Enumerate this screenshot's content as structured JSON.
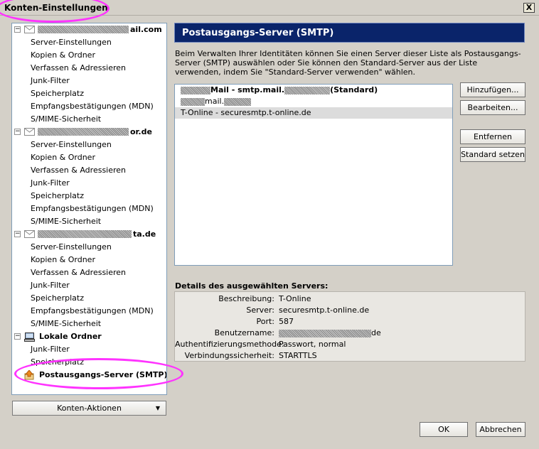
{
  "window": {
    "title": "Konten-Einstellungen",
    "close_label": "X"
  },
  "tree": {
    "accounts": [
      {
        "name_suffix": "ail.com",
        "expander": "−",
        "items": [
          "Server-Einstellungen",
          "Kopien & Ordner",
          "Verfassen & Adressieren",
          "Junk-Filter",
          "Speicherplatz",
          "Empfangsbestätigungen (MDN)",
          "S/MIME-Sicherheit"
        ]
      },
      {
        "name_suffix": "or.de",
        "expander": "−",
        "items": [
          "Server-Einstellungen",
          "Kopien & Ordner",
          "Verfassen & Adressieren",
          "Junk-Filter",
          "Speicherplatz",
          "Empfangsbestätigungen (MDN)",
          "S/MIME-Sicherheit"
        ]
      },
      {
        "name_suffix": "ta.de",
        "expander": "−",
        "items": [
          "Server-Einstellungen",
          "Kopien & Ordner",
          "Verfassen & Adressieren",
          "Junk-Filter",
          "Speicherplatz",
          "Empfangsbestätigungen (MDN)",
          "S/MIME-Sicherheit"
        ]
      }
    ],
    "local": {
      "name": "Lokale Ordner",
      "expander": "−",
      "items": [
        "Junk-Filter",
        "Speicherplatz"
      ]
    },
    "smtp_item": "Postausgangs-Server (SMTP)"
  },
  "accounts_button": {
    "label": "Konten-Aktionen",
    "arrow": "▼"
  },
  "panel": {
    "header": "Postausgangs-Server (SMTP)",
    "description": "Beim Verwalten Ihrer Identitäten können Sie einen Server dieser Liste als Postausgangs-Server (SMTP) auswählen oder Sie können den Standard-Server aus der Liste verwenden, indem Sie \"Standard-Server verwenden\" wählen.",
    "servers": [
      {
        "text_a": "Mail - smtp.mail.",
        "text_b": "(Standard)"
      },
      {
        "text_a": "mail."
      },
      {
        "text_a": "T-Online - securesmtp.t-online.de"
      }
    ],
    "buttons": {
      "add": "Hinzufügen...",
      "edit": "Bearbeiten...",
      "remove": "Entfernen",
      "set_default": "Standard setzen"
    },
    "details_title": "Details des ausgewählten Servers:",
    "details": [
      {
        "label": "Beschreibung:",
        "value": "T-Online"
      },
      {
        "label": "Server:",
        "value": "securesmtp.t-online.de"
      },
      {
        "label": "Port:",
        "value": "587"
      },
      {
        "label": "Benutzername:",
        "value": "de"
      },
      {
        "label": "Authentifizierungsmethode:",
        "value": "Passwort, normal"
      },
      {
        "label": "Verbindungssicherheit:",
        "value": "STARTTLS"
      }
    ]
  },
  "footer": {
    "ok": "OK",
    "cancel": "Abbrechen"
  },
  "colors": {
    "header_bg": "#0a246a",
    "highlight": "#ff33ff",
    "selection": "#dcdcdc"
  }
}
